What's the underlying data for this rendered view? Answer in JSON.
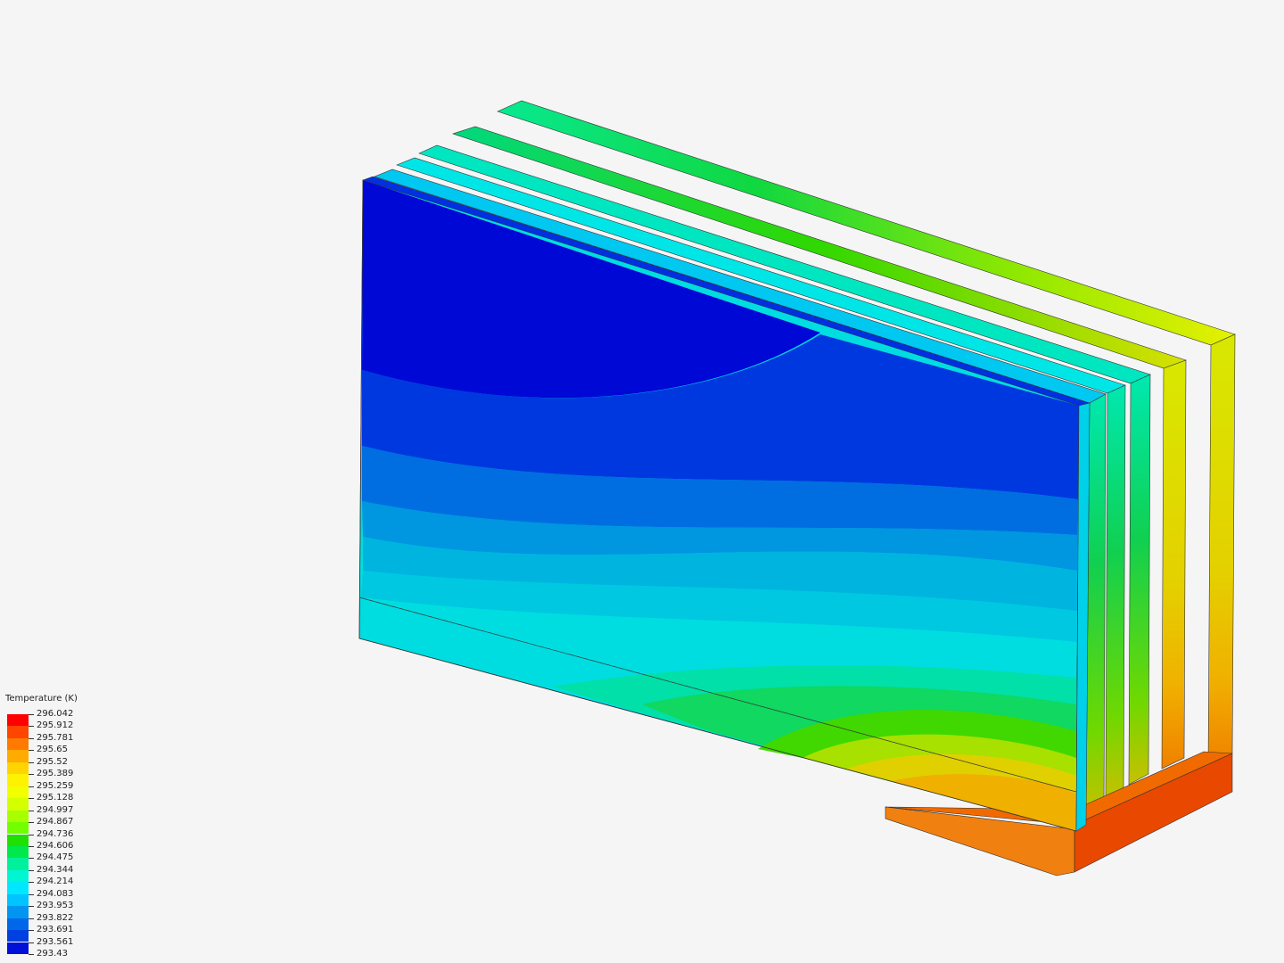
{
  "legend": {
    "title": "Temperature (K)",
    "labels": [
      "296.042",
      "295.912",
      "295.781",
      "295.65",
      "295.52",
      "295.389",
      "295.259",
      "295.128",
      "294.997",
      "294.867",
      "294.736",
      "294.606",
      "294.475",
      "294.344",
      "294.214",
      "294.083",
      "293.953",
      "293.822",
      "293.691",
      "293.561",
      "293.43"
    ],
    "colors": [
      "#ff0000",
      "#ff4500",
      "#ff7a00",
      "#ffab00",
      "#ffd400",
      "#fff200",
      "#f2ff00",
      "#d4ff00",
      "#a8ff00",
      "#72ff00",
      "#1fe000",
      "#00e84a",
      "#00f09b",
      "#00f6d2",
      "#00e8ff",
      "#00c4ff",
      "#0096f0",
      "#0068e8",
      "#0040e0",
      "#0010d8"
    ]
  },
  "colors": {
    "background": "#f5f5f5",
    "fin_front": "#0008d6"
  }
}
